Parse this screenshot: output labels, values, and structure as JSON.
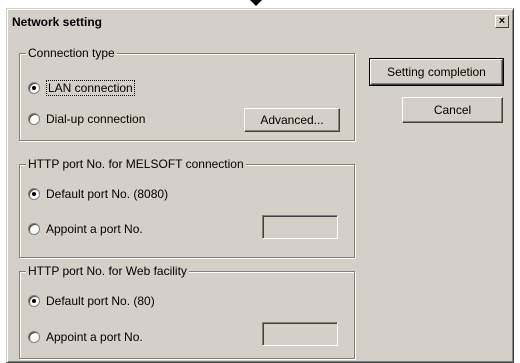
{
  "dialog": {
    "title": "Network setting",
    "close_glyph": "×"
  },
  "connection_type": {
    "legend": "Connection type",
    "options": [
      {
        "label": "LAN connection",
        "checked": true
      },
      {
        "label": "Dial-up connection",
        "checked": false
      }
    ],
    "advanced_button": "Advanced..."
  },
  "melsoft_port": {
    "legend": "HTTP port No. for MELSOFT connection",
    "options": [
      {
        "label": "Default port No. (8080)",
        "checked": true
      },
      {
        "label": "Appoint a port No.",
        "checked": false
      }
    ],
    "port_value": ""
  },
  "web_port": {
    "legend": "HTTP port No. for Web facility",
    "options": [
      {
        "label": "Default port No. (80)",
        "checked": true
      },
      {
        "label": "Appoint a port No.",
        "checked": false
      }
    ],
    "port_value": ""
  },
  "buttons": {
    "setting_completion": "Setting completion",
    "cancel": "Cancel"
  }
}
